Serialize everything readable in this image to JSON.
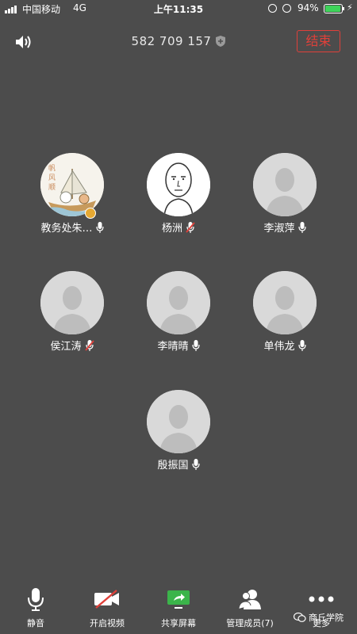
{
  "status_bar": {
    "carrier": "中国移动",
    "network": "4G",
    "time": "上午11:35",
    "battery_percent": "94%",
    "battery_level": 0.94
  },
  "header": {
    "meeting_id": "582 709 157",
    "end_label": "结束"
  },
  "participants": [
    {
      "name": "教务处朱…",
      "mic": "on",
      "avatar": "custom-photo",
      "host": true
    },
    {
      "name": "杨洲",
      "mic": "muted",
      "avatar": "drawn-face"
    },
    {
      "name": "李淑萍",
      "mic": "on",
      "avatar": "default"
    },
    {
      "name": "侯江涛",
      "mic": "muted",
      "avatar": "default"
    },
    {
      "name": "李晴晴",
      "mic": "on",
      "avatar": "default"
    },
    {
      "name": "单伟龙",
      "mic": "on",
      "avatar": "default"
    },
    {
      "name": "殷振国",
      "mic": "on",
      "avatar": "default"
    }
  ],
  "toolbar": {
    "mute_label": "静音",
    "video_label": "开启视频",
    "share_label": "共享屏幕",
    "members_label": "管理成员(7)",
    "more_label": "更多"
  },
  "watermark": {
    "text": "商丘学院"
  },
  "colors": {
    "background": "#4c4c4c",
    "end_red": "#e0403a",
    "share_green": "#3bb44a",
    "video_red": "#e0403a"
  }
}
